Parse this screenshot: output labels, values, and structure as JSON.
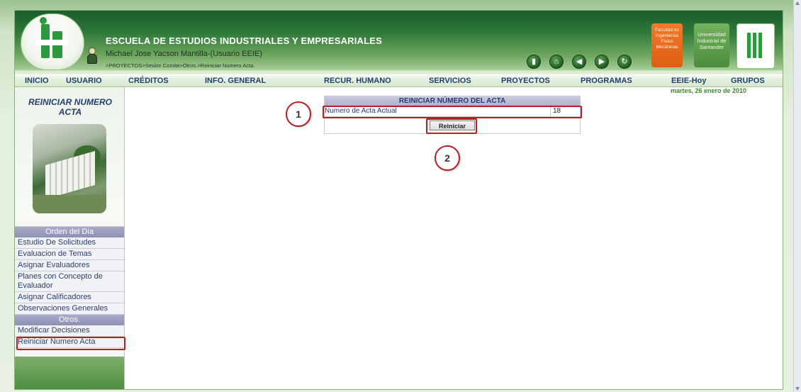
{
  "header": {
    "school_name": "ESCUELA DE ESTUDIOS INDUSTRIALES Y EMPRESARIALES",
    "user_name": "Michael Jose Yacson Mantilla-(Usuario EEIE)",
    "breadcrumb": ">PROYECTOS>Sesion Comite>Otros.>Reiniciar Numero Acta.",
    "icons": [
      "door-icon",
      "home-icon",
      "back-arrow-icon",
      "forward-arrow-icon",
      "refresh-icon"
    ],
    "faculty_badge": "Facultad de Ingenierías Físico Mecánicas",
    "university_badge": "Universidad Industrial de Santander"
  },
  "nav": {
    "items": [
      "INICIO",
      "USUARIO",
      "CRÉDITOS",
      "INFO. GENERAL",
      "RECUR. HUMANO",
      "SERVICIOS",
      "PROYECTOS",
      "PROGRAMAS",
      "EEIE-Hoy",
      "GRUPOS"
    ]
  },
  "date": "martes, 26 enero de 2010",
  "sidebar": {
    "title": "REINICIAR NUMERO ACTA",
    "menu": {
      "heading1": "Orden del Dia",
      "items1": [
        "Estudio De Solicitudes",
        "Evaluacion de Temas",
        "Asignar Evaluadores",
        "Planes con Concepto de Evaluador",
        "Asignar Calificadores",
        "Observaciones Generales"
      ],
      "heading2": "Otros.",
      "items2": [
        "Modificar Decisiones",
        "Reiniciar Numero Acta"
      ]
    }
  },
  "panel": {
    "title": "REINICIAR NÚMERO DEL ACTA",
    "row_label": "Numero de Acta Actual",
    "row_value": "18",
    "button_label": "Reiniciar"
  },
  "annotations": {
    "marker1": "1",
    "marker2": "2"
  },
  "colors": {
    "header_dark_green": "#1a5c2a",
    "nav_text": "#1f3f6e",
    "annotation_red": "#b81f24",
    "date_green": "#3a8a2c"
  }
}
